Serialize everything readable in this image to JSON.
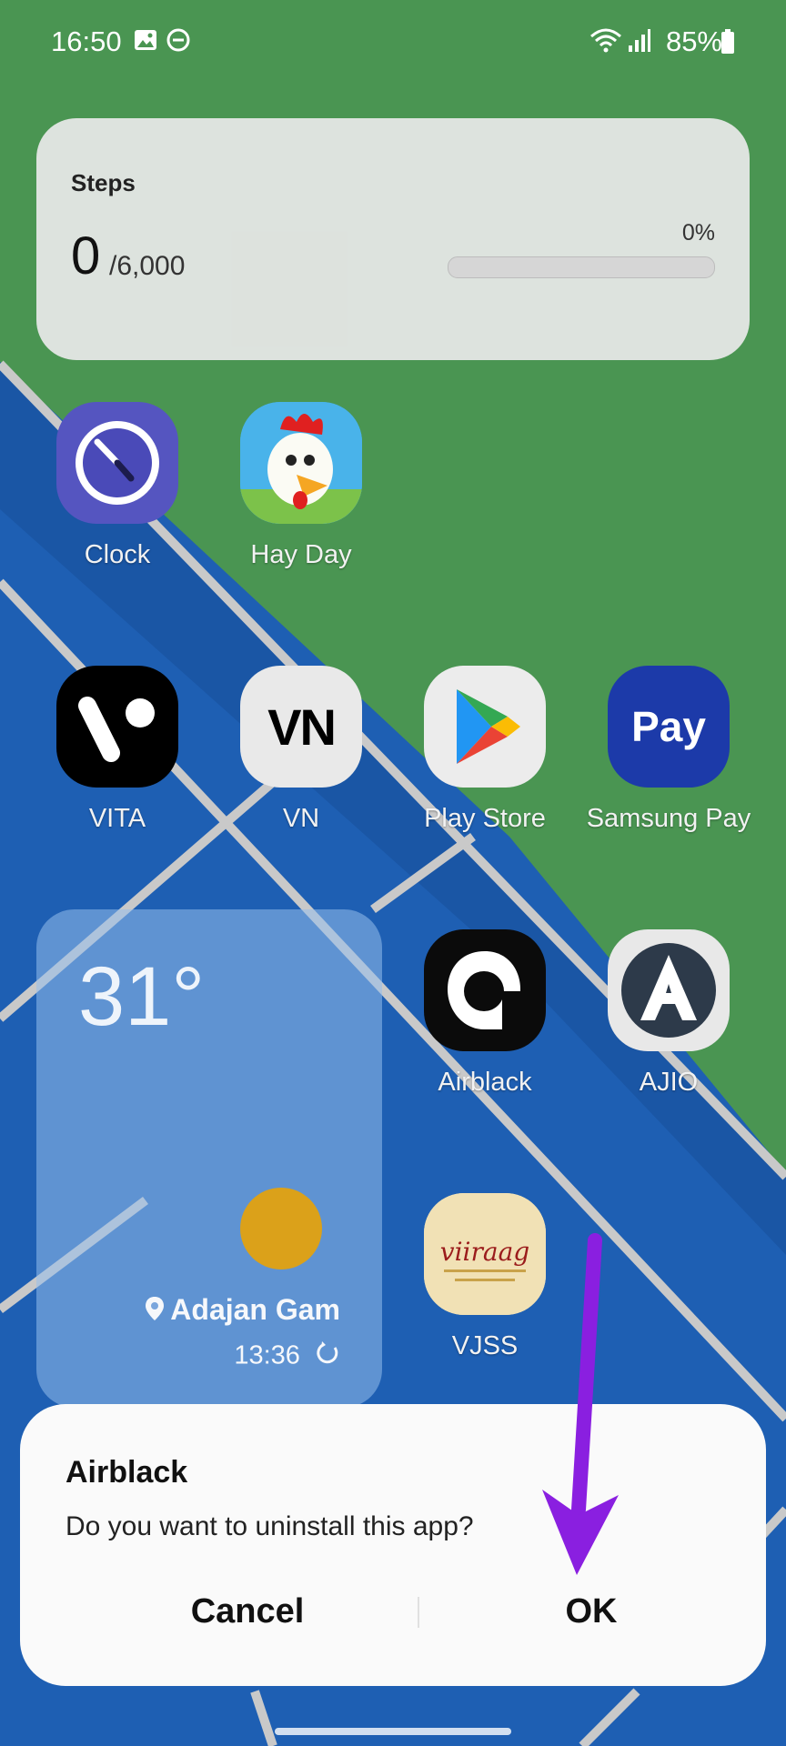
{
  "status_bar": {
    "time": "16:50",
    "battery": "85%"
  },
  "steps_widget": {
    "title": "Steps",
    "count": "0",
    "goal": "/6,000",
    "percent": "0%",
    "progress_fraction": 0
  },
  "apps": [
    {
      "label": "Clock"
    },
    {
      "label": "Hay Day"
    },
    {
      "label": "VITA"
    },
    {
      "label": "VN"
    },
    {
      "label": "Play Store"
    },
    {
      "label": "Samsung Pay"
    },
    {
      "label": "Airblack"
    },
    {
      "label": "AJIO"
    },
    {
      "label": "VJSS"
    }
  ],
  "icon_text": {
    "vn": "VN",
    "pay": "Pay",
    "viiraag": "viiraag"
  },
  "weather_widget": {
    "temperature": "31°",
    "location": "Adajan Gam",
    "updated": "13:36"
  },
  "dialog": {
    "title": "Airblack",
    "message": "Do you want to uninstall this app?",
    "cancel": "Cancel",
    "ok": "OK"
  },
  "colors": {
    "wallpaper_green": "#4a9552",
    "wallpaper_blue": "#1e5fb3",
    "arrow_purple": "#8a1fe0"
  }
}
